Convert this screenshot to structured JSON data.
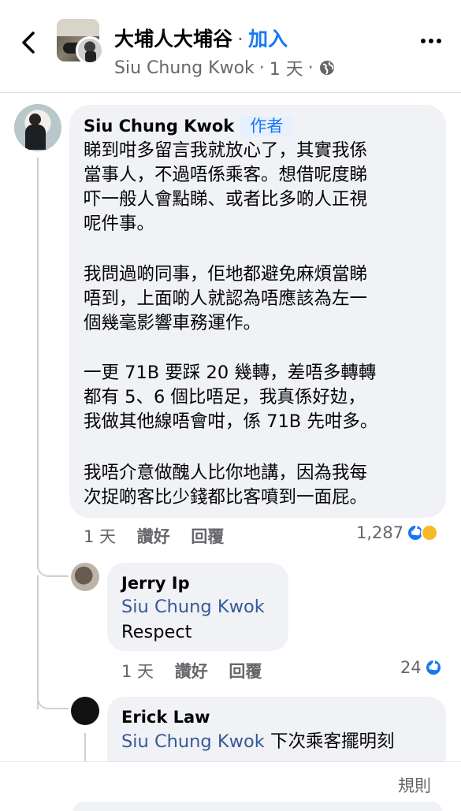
{
  "header": {
    "group_name": "大埔人大埔谷",
    "separator": "·",
    "join_label": "加入",
    "author": "Siu Chung Kwok",
    "time": "1 天",
    "back_icon": "chevron-left-icon",
    "more_icon": "more-dots-icon",
    "privacy_icon": "globe-icon"
  },
  "comments": [
    {
      "author": "Siu Chung Kwok",
      "badge": "作者",
      "paragraphs": [
        "睇到咁多留言我就放心了，其實我係\n當事人，不過唔係乘客。想借呢度睇\n吓一般人會點睇、或者比多啲人正視\n呢件事。",
        "我問過啲同事，佢地都避免麻煩當睇\n唔到，上面啲人就認為唔應該為左一\n個幾毫影響車務運作。",
        "一更 71B 要踩 20 幾轉，差唔多轉轉\n都有 5、6 個比唔足，我真係好攰，\n我做其他線唔會咁，係 71B 先咁多。",
        "我唔介意做醜人比你地講，因為我每\n次捉啲客比少錢都比客噴到一面屁。"
      ],
      "time": "1 天",
      "like_label": "讚好",
      "reply_label": "回覆",
      "reaction_count": "1,287"
    },
    {
      "author": "Jerry Ip",
      "mention": "Siu Chung Kwok",
      "text": "Respect",
      "time": "1 天",
      "like_label": "讚好",
      "reply_label": "回覆",
      "reaction_count": "24"
    },
    {
      "author": "Erick Law",
      "mention": "Siu Chung Kwok",
      "text": " 下次乘客擺明刻"
    }
  ],
  "footer": {
    "rules_label": "規則"
  }
}
